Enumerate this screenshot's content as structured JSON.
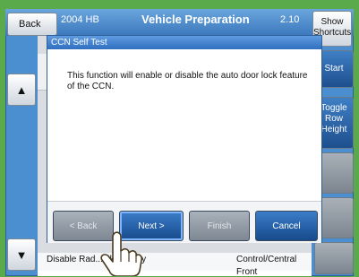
{
  "header": {
    "back_label": "Back",
    "year": "2004 HB",
    "title": "Vehicle Preparation",
    "version": "2.10",
    "shortcuts_label": "Show Shortcuts"
  },
  "dialog": {
    "title": "CCN Self Test",
    "message": "This function will enable or disable the auto door lock feature of the CCN."
  },
  "wizard_buttons": {
    "back": "< Back",
    "next": "Next >",
    "finish": "Finish",
    "cancel": "Cancel"
  },
  "right_buttons": {
    "start": "Start",
    "toggle_row_height": "Toggle Row Height"
  },
  "background_list": {
    "row_partial": "Disable Rad... ck Display",
    "cell1": "Control/Central",
    "cell2": "Front"
  },
  "colors": {
    "frame_blue": "#4b8fd0",
    "active_button": "#174b8c",
    "disabled_button": "#7e8893",
    "outer_green": "#5aa94a"
  },
  "icons": {
    "scroll_up": "triangle-up",
    "scroll_down": "triangle-down",
    "pointer": "hand-pointer"
  }
}
